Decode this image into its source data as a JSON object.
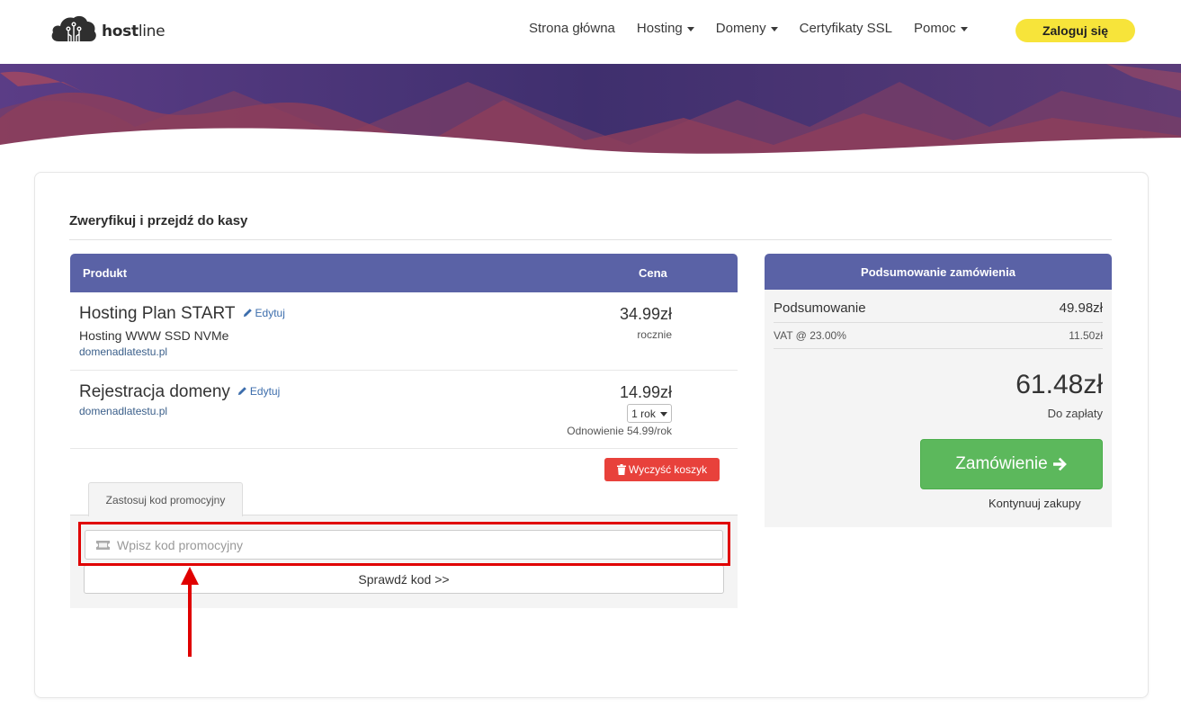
{
  "header": {
    "logo_text_bold": "host",
    "logo_text_light": "line",
    "nav": [
      {
        "label": "Strona główna",
        "dropdown": false
      },
      {
        "label": "Hosting",
        "dropdown": true
      },
      {
        "label": "Domeny",
        "dropdown": true
      },
      {
        "label": "Certyfikaty SSL",
        "dropdown": false
      },
      {
        "label": "Pomoc",
        "dropdown": true
      }
    ],
    "login_label": "Zaloguj się"
  },
  "page": {
    "title": "Zweryfikuj i przejdź do kasy"
  },
  "cart": {
    "col_product": "Produkt",
    "col_price": "Cena",
    "items": [
      {
        "name": "Hosting Plan START",
        "edit_label": "Edytuj",
        "description": "Hosting WWW SSD NVMe",
        "domain": "domenadlatestu.pl",
        "price": "34.99zł",
        "billing": "rocznie"
      },
      {
        "name": "Rejestracja domeny",
        "edit_label": "Edytuj",
        "domain": "domenadlatestu.pl",
        "price": "14.99zł",
        "period_selected": "1 rok",
        "renewal": "Odnowienie 54.99/rok"
      }
    ],
    "clear_label": "Wyczyść koszyk"
  },
  "promo": {
    "tab_label": "Zastosuj kod promocyjny",
    "input_value": "",
    "input_placeholder": "Wpisz kod promocyjny",
    "check_label": "Sprawdź kod >>"
  },
  "summary": {
    "heading": "Podsumowanie zamówienia",
    "subtotal_label": "Podsumowanie",
    "subtotal_value": "49.98zł",
    "vat_label": "VAT @ 23.00%",
    "vat_value": "11.50zł",
    "total": "61.48zł",
    "total_label": "Do zapłaty",
    "order_label": "Zamówienie",
    "continue_label": "Kontynuuj zakupy"
  },
  "colors": {
    "accent": "#5a62a6",
    "login_button": "#f7e43a",
    "order_button": "#5cb85c",
    "clear_button": "#e8413b",
    "annotation": "#e00000"
  },
  "icons": {
    "logo": "cloud-circuit-icon",
    "edit": "pencil-icon",
    "clear": "trash-icon",
    "promo_input": "ticket-icon",
    "order": "arrow-right-icon"
  }
}
